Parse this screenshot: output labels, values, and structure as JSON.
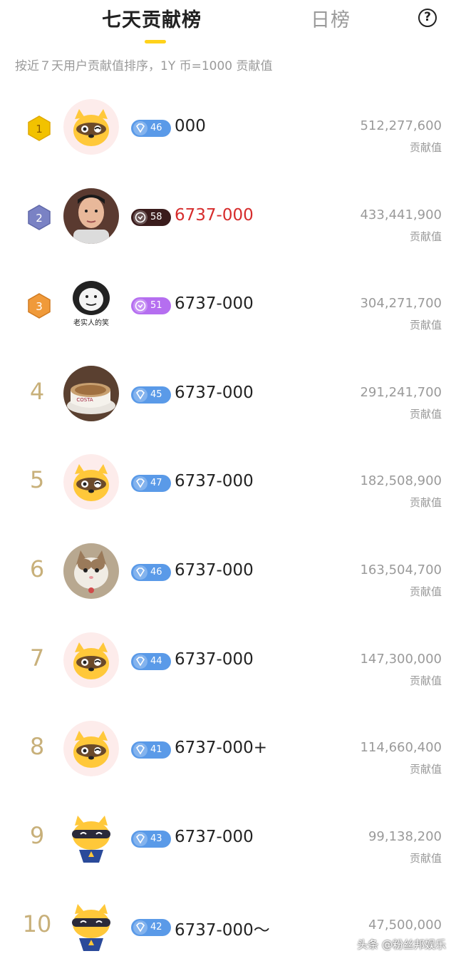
{
  "header": {
    "tab_weekly": "七天贡献榜",
    "tab_daily": "日榜",
    "help_symbol": "?"
  },
  "subtitle": "按近７天用户贡献值排序，1Y 币=1000 贡献值",
  "score_label": "贡献值",
  "colors": {
    "accent": "#ffd21a",
    "rank1": "#f2c200",
    "rank2": "#7a82c4",
    "rank3": "#f09a3a",
    "level_blue": "#5a9ae8",
    "level_dark": "#3a1c1c",
    "level_purple": "#b56ef0",
    "name_red": "#d62c2c"
  },
  "rows": [
    {
      "rank": "1",
      "level": "46",
      "name": "000",
      "score": "512,277,600",
      "score_label": "贡献值",
      "avatar": "raccoon-avatar"
    },
    {
      "rank": "2",
      "level": "58",
      "name": "6737-000",
      "score": "433,441,900",
      "score_label": "贡献值",
      "avatar": "photo-avatar"
    },
    {
      "rank": "3",
      "level": "51",
      "name": "6737-000",
      "score": "304,271,700",
      "score_label": "贡献值",
      "avatar": "meme-avatar",
      "avatar_text": "老实人的笑"
    },
    {
      "rank": "4",
      "level": "45",
      "name": "6737-000",
      "score": "291,241,700",
      "score_label": "贡献值",
      "avatar": "coffee-avatar",
      "avatar_text": "COSTA"
    },
    {
      "rank": "5",
      "level": "47",
      "name": "6737-000",
      "score": "182,508,900",
      "score_label": "贡献值",
      "avatar": "raccoon-avatar"
    },
    {
      "rank": "6",
      "level": "46",
      "name": "6737-000",
      "score": "163,504,700",
      "score_label": "贡献值",
      "avatar": "cat-avatar"
    },
    {
      "rank": "7",
      "level": "44",
      "name": "6737-000",
      "score": "147,300,000",
      "score_label": "贡献值",
      "avatar": "raccoon-avatar"
    },
    {
      "rank": "8",
      "level": "41",
      "name": "6737-000+",
      "score": "114,660,400",
      "score_label": "贡献值",
      "avatar": "raccoon-avatar"
    },
    {
      "rank": "9",
      "level": "43",
      "name": "6737-000",
      "score": "99,138,200",
      "score_label": "贡献值",
      "avatar": "raccoon-costume-avatar"
    },
    {
      "rank": "10",
      "level": "42",
      "name": "6737-000～",
      "score": "47,500,000",
      "score_label": "",
      "avatar": "raccoon-costume-avatar"
    }
  ],
  "watermark": "头条 @粉丝邦娱乐"
}
